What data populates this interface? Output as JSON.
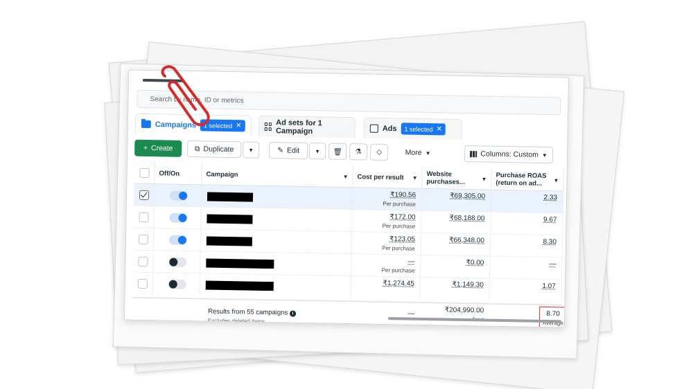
{
  "search": {
    "placeholder": "Search by name, ID or metrics"
  },
  "tabs": [
    {
      "label": "Campaigns",
      "badge": "1 selected",
      "icon": "folder-icon"
    },
    {
      "label": "Ad sets for 1 Campaign",
      "icon": "grid-icon"
    },
    {
      "label": "Ads",
      "badge": "1 selected",
      "icon": "square-icon"
    }
  ],
  "toolbar": {
    "create": "Create",
    "duplicate": "Duplicate",
    "edit": "Edit",
    "more": "More",
    "columns": "Columns: Custom"
  },
  "table": {
    "headers": {
      "toggle": "Off/On",
      "campaign": "Campaign",
      "cost": "Cost per result",
      "website": "Website purchases...",
      "roas": "Purchase ROAS (return on ad..."
    },
    "rows": [
      {
        "checked": true,
        "on": true,
        "cost": "₹190.56",
        "cost_sub": "Per purchase",
        "website": "₹69,305.00",
        "roas": "2.33"
      },
      {
        "checked": false,
        "on": true,
        "cost": "₹172.00",
        "cost_sub": "Per purchase",
        "website": "₹68,188.00",
        "roas": "9.67"
      },
      {
        "checked": false,
        "on": true,
        "cost": "₹123.05",
        "cost_sub": "Per purchase",
        "website": "₹66,348.00",
        "roas": "8.30"
      },
      {
        "checked": false,
        "on": false,
        "cost": "—",
        "cost_sub": "Per purchase",
        "website": "₹0.00",
        "roas": "—"
      },
      {
        "checked": false,
        "on": false,
        "cost": "₹1,274.45",
        "cost_sub": "",
        "website": "₹1,149.30",
        "roas": "1.07"
      }
    ],
    "footer": {
      "results": "Results from 55 campaigns",
      "excludes": "Excludes deleted items",
      "cost": "—",
      "website": "₹204,990.00",
      "website_sub": "Total",
      "roas": "8.70",
      "roas_sub": "Average"
    }
  },
  "colors": {
    "accent": "#1877f2",
    "create": "#1b8a4f",
    "highlight": "#e02424",
    "clip": "#d62a2a"
  }
}
